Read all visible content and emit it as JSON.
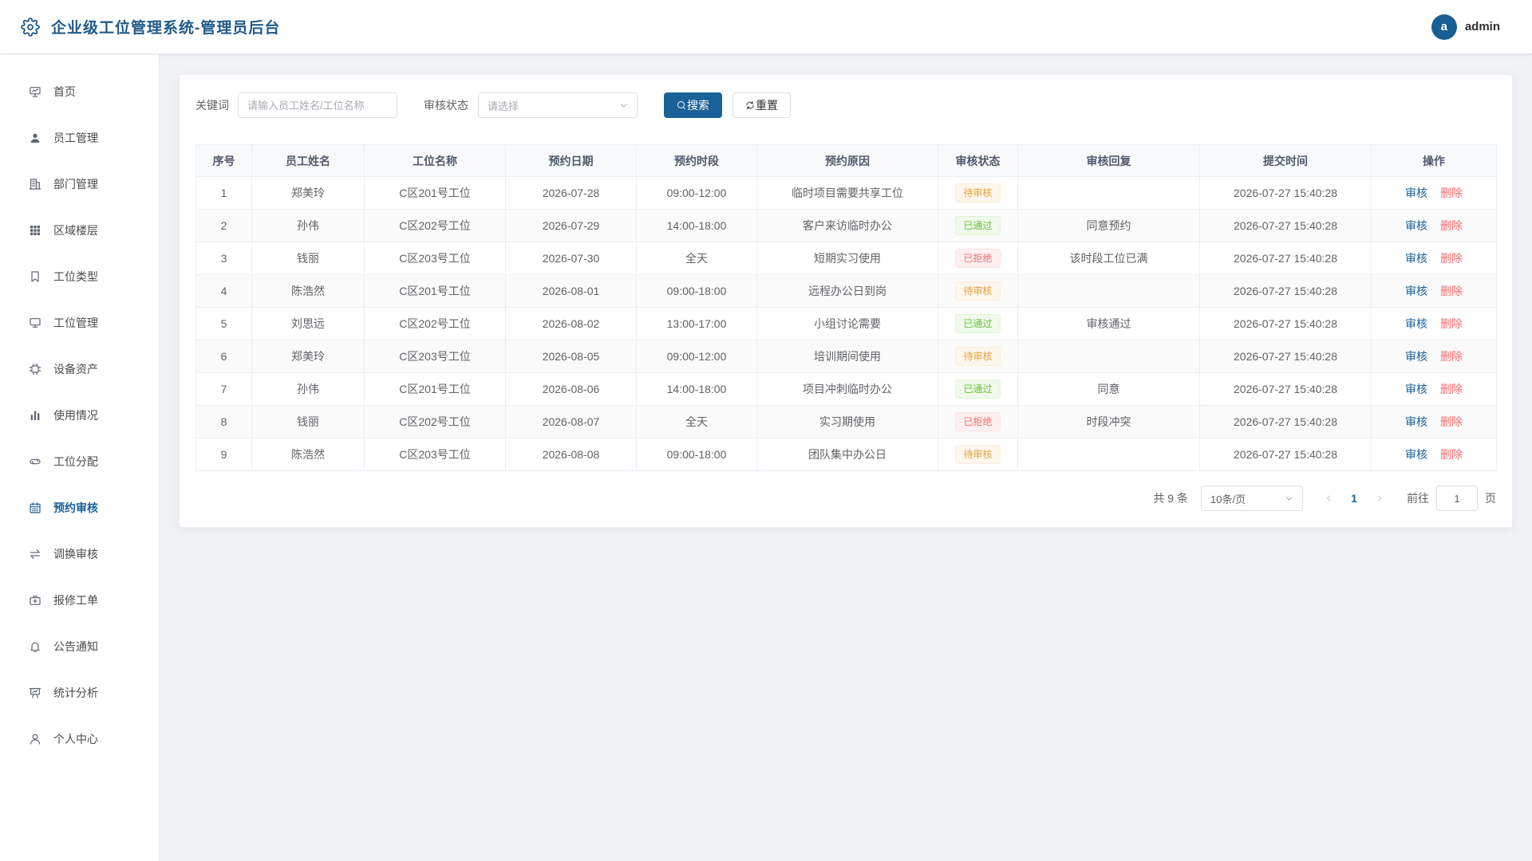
{
  "theme": {
    "accent": "#1a6198",
    "title_color": "#1f5a8a",
    "avatar_bg": "#175e94",
    "danger": "#f56c6c",
    "page_bg": "#f0f2f5"
  },
  "header": {
    "icon": "setting-icon",
    "title": "企业级工位管理系统-管理员后台",
    "avatar_letter": "a",
    "username": "admin"
  },
  "sidebar": {
    "items": [
      {
        "label": "首页",
        "icon": "dashboard-icon"
      },
      {
        "label": "员工管理",
        "icon": "user-filled-icon"
      },
      {
        "label": "部门管理",
        "icon": "office-building-icon"
      },
      {
        "label": "区域楼层",
        "icon": "grid-icon"
      },
      {
        "label": "工位类型",
        "icon": "collection-tag-icon"
      },
      {
        "label": "工位管理",
        "icon": "monitor-icon"
      },
      {
        "label": "设备资产",
        "icon": "cpu-icon"
      },
      {
        "label": "使用情况",
        "icon": "histogram-icon"
      },
      {
        "label": "工位分配",
        "icon": "connection-icon"
      },
      {
        "label": "预约审核",
        "icon": "calendar-icon",
        "active": true
      },
      {
        "label": "调换审核",
        "icon": "switch-icon"
      },
      {
        "label": "报修工单",
        "icon": "first-aid-kit-icon"
      },
      {
        "label": "公告通知",
        "icon": "bell-icon"
      },
      {
        "label": "统计分析",
        "icon": "data-board-icon"
      },
      {
        "label": "个人中心",
        "icon": "user-icon"
      }
    ]
  },
  "search": {
    "keyword_label": "关键词",
    "keyword_placeholder": "请输入员工姓名/工位名称",
    "status_label": "审核状态",
    "status_placeholder": "请选择",
    "select_icon": "arrow-down-icon",
    "search_icon": "search-icon",
    "search_button": "搜索",
    "reset_icon": "refresh-icon",
    "reset_button": "重置"
  },
  "table": {
    "columns": [
      "序号",
      "员工姓名",
      "工位名称",
      "预约日期",
      "预约时段",
      "预约原因",
      "审核状态",
      "审核回复",
      "提交时间",
      "操作"
    ],
    "rows": [
      {
        "no": 1,
        "employee": "郑美玲",
        "workstation": "C区201号工位",
        "date": "2026-07-28",
        "slot": "09:00-12:00",
        "reason": "临时项目需要共享工位",
        "status": "待审核",
        "reply": "",
        "submitted_at": "2026-07-27 15:40:28"
      },
      {
        "no": 2,
        "employee": "孙伟",
        "workstation": "C区202号工位",
        "date": "2026-07-29",
        "slot": "14:00-18:00",
        "reason": "客户来访临时办公",
        "status": "已通过",
        "reply": "同意预约",
        "submitted_at": "2026-07-27 15:40:28"
      },
      {
        "no": 3,
        "employee": "钱丽",
        "workstation": "C区203号工位",
        "date": "2026-07-30",
        "slot": "全天",
        "reason": "短期实习使用",
        "status": "已拒绝",
        "reply": "该时段工位已满",
        "submitted_at": "2026-07-27 15:40:28"
      },
      {
        "no": 4,
        "employee": "陈浩然",
        "workstation": "C区201号工位",
        "date": "2026-08-01",
        "slot": "09:00-18:00",
        "reason": "远程办公日到岗",
        "status": "待审核",
        "reply": "",
        "submitted_at": "2026-07-27 15:40:28"
      },
      {
        "no": 5,
        "employee": "刘思远",
        "workstation": "C区202号工位",
        "date": "2026-08-02",
        "slot": "13:00-17:00",
        "reason": "小组讨论需要",
        "status": "已通过",
        "reply": "审核通过",
        "submitted_at": "2026-07-27 15:40:28"
      },
      {
        "no": 6,
        "employee": "郑美玲",
        "workstation": "C区203号工位",
        "date": "2026-08-05",
        "slot": "09:00-12:00",
        "reason": "培训期间使用",
        "status": "待审核",
        "reply": "",
        "submitted_at": "2026-07-27 15:40:28"
      },
      {
        "no": 7,
        "employee": "孙伟",
        "workstation": "C区201号工位",
        "date": "2026-08-06",
        "slot": "14:00-18:00",
        "reason": "项目冲刺临时办公",
        "status": "已通过",
        "reply": "同意",
        "submitted_at": "2026-07-27 15:40:28"
      },
      {
        "no": 8,
        "employee": "钱丽",
        "workstation": "C区202号工位",
        "date": "2026-08-07",
        "slot": "全天",
        "reason": "实习期使用",
        "status": "已拒绝",
        "reply": "时段冲突",
        "submitted_at": "2026-07-27 15:40:28"
      },
      {
        "no": 9,
        "employee": "陈浩然",
        "workstation": "C区203号工位",
        "date": "2026-08-08",
        "slot": "09:00-18:00",
        "reason": "团队集中办公日",
        "status": "待审核",
        "reply": "",
        "submitted_at": "2026-07-27 15:40:28"
      }
    ],
    "actions": {
      "review": "审核",
      "delete": "删除"
    }
  },
  "status_styles": {
    "待审核": {
      "text": "#e6a23c",
      "bg": "#fdf6ec",
      "border": "#faecd8"
    },
    "已通过": {
      "text": "#67c23a",
      "bg": "#f0f9eb",
      "border": "#e1f3d8"
    },
    "已拒绝": {
      "text": "#f56c6c",
      "bg": "#fef0f0",
      "border": "#fde2e2"
    }
  },
  "pagination": {
    "total_text": "共 9 条",
    "page_size": "10条/页",
    "page_size_icon": "arrow-down-icon",
    "prev_icon": "arrow-left-icon",
    "current_page": "1",
    "next_icon": "arrow-right-icon",
    "goto_label": "前往",
    "goto_value": "1",
    "goto_suffix": "页"
  }
}
